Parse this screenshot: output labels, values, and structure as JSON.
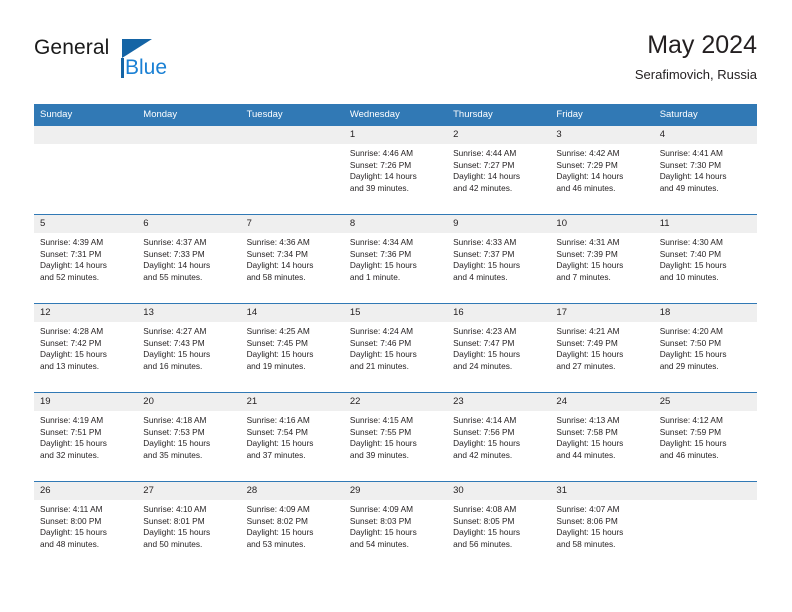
{
  "brand": {
    "word_one": "General",
    "word_two": "Blue",
    "triangle_icon": "brand-triangle-icon"
  },
  "header": {
    "title": "May 2024",
    "subtitle": "Serafimovich, Russia"
  },
  "colors": {
    "header_blue": "#3179b5",
    "daynum_gray": "#efefef",
    "brand_blue": "#1a80d4",
    "brand_dark": "#1a1a1a",
    "text": "#231f20"
  },
  "weekdays": [
    "Sunday",
    "Monday",
    "Tuesday",
    "Wednesday",
    "Thursday",
    "Friday",
    "Saturday"
  ],
  "weeks": [
    [
      {
        "day": "",
        "empty": true,
        "sunrise": "",
        "sunset": "",
        "daylight_1": "",
        "daylight_2": ""
      },
      {
        "day": "",
        "empty": true,
        "sunrise": "",
        "sunset": "",
        "daylight_1": "",
        "daylight_2": ""
      },
      {
        "day": "",
        "empty": true,
        "sunrise": "",
        "sunset": "",
        "daylight_1": "",
        "daylight_2": ""
      },
      {
        "day": "1",
        "sunrise": "Sunrise: 4:46 AM",
        "sunset": "Sunset: 7:26 PM",
        "daylight_1": "Daylight: 14 hours",
        "daylight_2": "and 39 minutes."
      },
      {
        "day": "2",
        "sunrise": "Sunrise: 4:44 AM",
        "sunset": "Sunset: 7:27 PM",
        "daylight_1": "Daylight: 14 hours",
        "daylight_2": "and 42 minutes."
      },
      {
        "day": "3",
        "sunrise": "Sunrise: 4:42 AM",
        "sunset": "Sunset: 7:29 PM",
        "daylight_1": "Daylight: 14 hours",
        "daylight_2": "and 46 minutes."
      },
      {
        "day": "4",
        "sunrise": "Sunrise: 4:41 AM",
        "sunset": "Sunset: 7:30 PM",
        "daylight_1": "Daylight: 14 hours",
        "daylight_2": "and 49 minutes."
      }
    ],
    [
      {
        "day": "5",
        "sunrise": "Sunrise: 4:39 AM",
        "sunset": "Sunset: 7:31 PM",
        "daylight_1": "Daylight: 14 hours",
        "daylight_2": "and 52 minutes."
      },
      {
        "day": "6",
        "sunrise": "Sunrise: 4:37 AM",
        "sunset": "Sunset: 7:33 PM",
        "daylight_1": "Daylight: 14 hours",
        "daylight_2": "and 55 minutes."
      },
      {
        "day": "7",
        "sunrise": "Sunrise: 4:36 AM",
        "sunset": "Sunset: 7:34 PM",
        "daylight_1": "Daylight: 14 hours",
        "daylight_2": "and 58 minutes."
      },
      {
        "day": "8",
        "sunrise": "Sunrise: 4:34 AM",
        "sunset": "Sunset: 7:36 PM",
        "daylight_1": "Daylight: 15 hours",
        "daylight_2": "and 1 minute."
      },
      {
        "day": "9",
        "sunrise": "Sunrise: 4:33 AM",
        "sunset": "Sunset: 7:37 PM",
        "daylight_1": "Daylight: 15 hours",
        "daylight_2": "and 4 minutes."
      },
      {
        "day": "10",
        "sunrise": "Sunrise: 4:31 AM",
        "sunset": "Sunset: 7:39 PM",
        "daylight_1": "Daylight: 15 hours",
        "daylight_2": "and 7 minutes."
      },
      {
        "day": "11",
        "sunrise": "Sunrise: 4:30 AM",
        "sunset": "Sunset: 7:40 PM",
        "daylight_1": "Daylight: 15 hours",
        "daylight_2": "and 10 minutes."
      }
    ],
    [
      {
        "day": "12",
        "sunrise": "Sunrise: 4:28 AM",
        "sunset": "Sunset: 7:42 PM",
        "daylight_1": "Daylight: 15 hours",
        "daylight_2": "and 13 minutes."
      },
      {
        "day": "13",
        "sunrise": "Sunrise: 4:27 AM",
        "sunset": "Sunset: 7:43 PM",
        "daylight_1": "Daylight: 15 hours",
        "daylight_2": "and 16 minutes."
      },
      {
        "day": "14",
        "sunrise": "Sunrise: 4:25 AM",
        "sunset": "Sunset: 7:45 PM",
        "daylight_1": "Daylight: 15 hours",
        "daylight_2": "and 19 minutes."
      },
      {
        "day": "15",
        "sunrise": "Sunrise: 4:24 AM",
        "sunset": "Sunset: 7:46 PM",
        "daylight_1": "Daylight: 15 hours",
        "daylight_2": "and 21 minutes."
      },
      {
        "day": "16",
        "sunrise": "Sunrise: 4:23 AM",
        "sunset": "Sunset: 7:47 PM",
        "daylight_1": "Daylight: 15 hours",
        "daylight_2": "and 24 minutes."
      },
      {
        "day": "17",
        "sunrise": "Sunrise: 4:21 AM",
        "sunset": "Sunset: 7:49 PM",
        "daylight_1": "Daylight: 15 hours",
        "daylight_2": "and 27 minutes."
      },
      {
        "day": "18",
        "sunrise": "Sunrise: 4:20 AM",
        "sunset": "Sunset: 7:50 PM",
        "daylight_1": "Daylight: 15 hours",
        "daylight_2": "and 29 minutes."
      }
    ],
    [
      {
        "day": "19",
        "sunrise": "Sunrise: 4:19 AM",
        "sunset": "Sunset: 7:51 PM",
        "daylight_1": "Daylight: 15 hours",
        "daylight_2": "and 32 minutes."
      },
      {
        "day": "20",
        "sunrise": "Sunrise: 4:18 AM",
        "sunset": "Sunset: 7:53 PM",
        "daylight_1": "Daylight: 15 hours",
        "daylight_2": "and 35 minutes."
      },
      {
        "day": "21",
        "sunrise": "Sunrise: 4:16 AM",
        "sunset": "Sunset: 7:54 PM",
        "daylight_1": "Daylight: 15 hours",
        "daylight_2": "and 37 minutes."
      },
      {
        "day": "22",
        "sunrise": "Sunrise: 4:15 AM",
        "sunset": "Sunset: 7:55 PM",
        "daylight_1": "Daylight: 15 hours",
        "daylight_2": "and 39 minutes."
      },
      {
        "day": "23",
        "sunrise": "Sunrise: 4:14 AM",
        "sunset": "Sunset: 7:56 PM",
        "daylight_1": "Daylight: 15 hours",
        "daylight_2": "and 42 minutes."
      },
      {
        "day": "24",
        "sunrise": "Sunrise: 4:13 AM",
        "sunset": "Sunset: 7:58 PM",
        "daylight_1": "Daylight: 15 hours",
        "daylight_2": "and 44 minutes."
      },
      {
        "day": "25",
        "sunrise": "Sunrise: 4:12 AM",
        "sunset": "Sunset: 7:59 PM",
        "daylight_1": "Daylight: 15 hours",
        "daylight_2": "and 46 minutes."
      }
    ],
    [
      {
        "day": "26",
        "sunrise": "Sunrise: 4:11 AM",
        "sunset": "Sunset: 8:00 PM",
        "daylight_1": "Daylight: 15 hours",
        "daylight_2": "and 48 minutes."
      },
      {
        "day": "27",
        "sunrise": "Sunrise: 4:10 AM",
        "sunset": "Sunset: 8:01 PM",
        "daylight_1": "Daylight: 15 hours",
        "daylight_2": "and 50 minutes."
      },
      {
        "day": "28",
        "sunrise": "Sunrise: 4:09 AM",
        "sunset": "Sunset: 8:02 PM",
        "daylight_1": "Daylight: 15 hours",
        "daylight_2": "and 53 minutes."
      },
      {
        "day": "29",
        "sunrise": "Sunrise: 4:09 AM",
        "sunset": "Sunset: 8:03 PM",
        "daylight_1": "Daylight: 15 hours",
        "daylight_2": "and 54 minutes."
      },
      {
        "day": "30",
        "sunrise": "Sunrise: 4:08 AM",
        "sunset": "Sunset: 8:05 PM",
        "daylight_1": "Daylight: 15 hours",
        "daylight_2": "and 56 minutes."
      },
      {
        "day": "31",
        "sunrise": "Sunrise: 4:07 AM",
        "sunset": "Sunset: 8:06 PM",
        "daylight_1": "Daylight: 15 hours",
        "daylight_2": "and 58 minutes."
      },
      {
        "day": "",
        "empty": true,
        "sunrise": "",
        "sunset": "",
        "daylight_1": "",
        "daylight_2": ""
      }
    ]
  ]
}
